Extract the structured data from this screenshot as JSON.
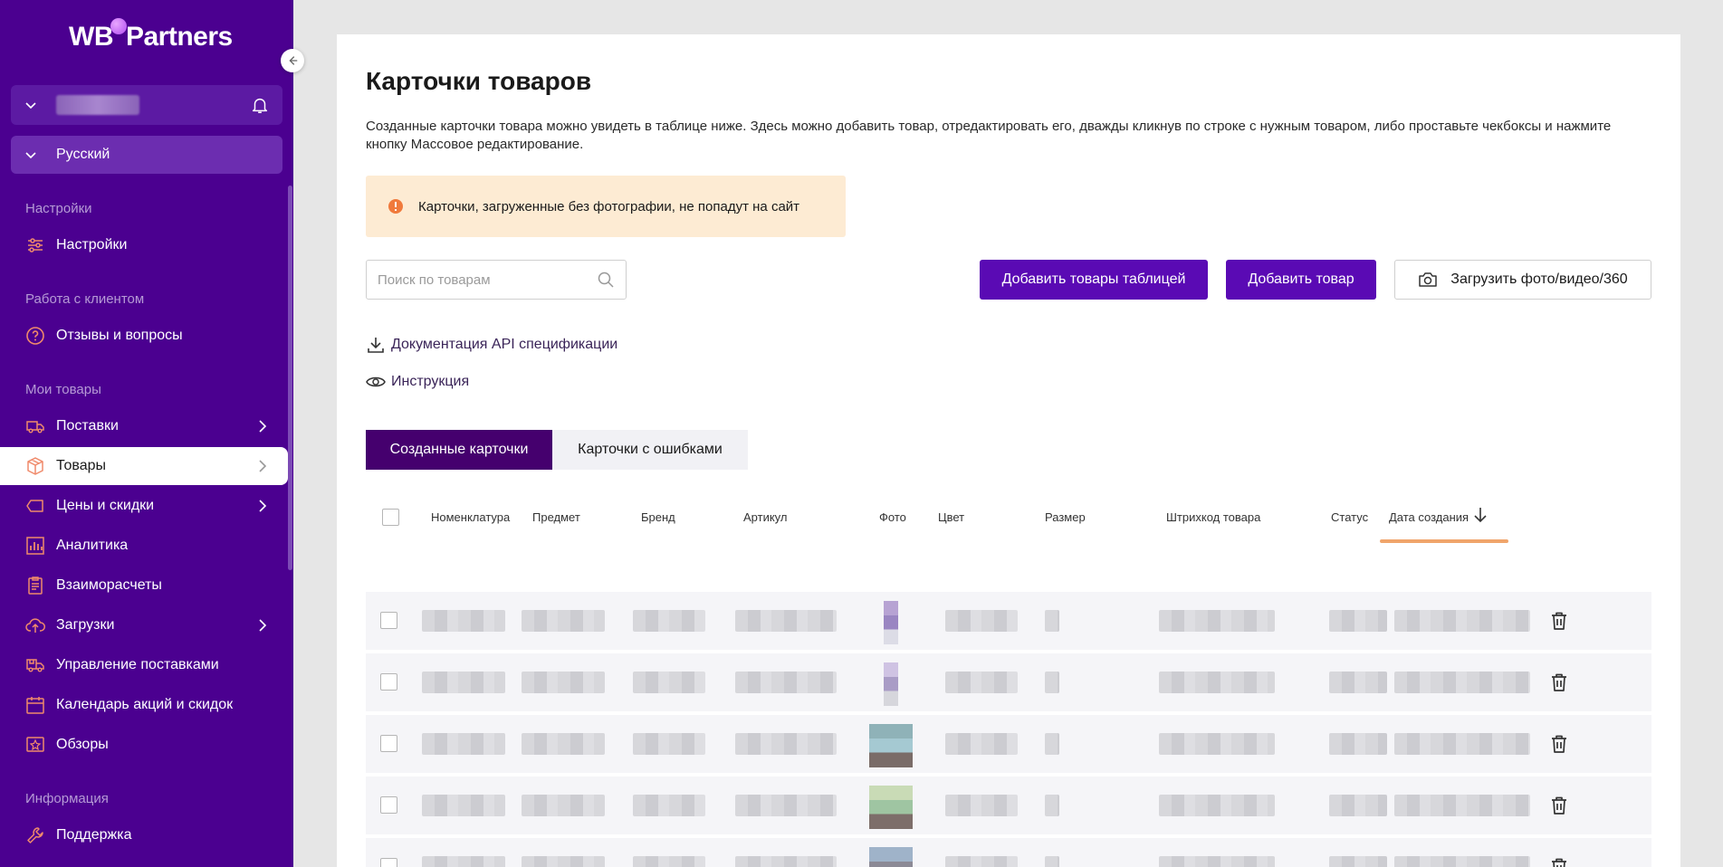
{
  "brand": {
    "logo_left": "WB",
    "logo_right": "Partners"
  },
  "sidebar": {
    "language": "Русский",
    "sections": [
      {
        "title": "Настройки",
        "items": [
          {
            "label": "Настройки",
            "icon": "sliders-icon"
          }
        ]
      },
      {
        "title": "Работа с клиентом",
        "items": [
          {
            "label": "Отзывы и вопросы",
            "icon": "question-circle-icon"
          }
        ]
      },
      {
        "title": "Мои товары",
        "items": [
          {
            "label": "Поставки",
            "icon": "truck-icon",
            "has_arrow": true
          },
          {
            "label": "Товары",
            "icon": "box-icon",
            "has_arrow": true,
            "active": true
          },
          {
            "label": "Цены и скидки",
            "icon": "tag-icon",
            "has_arrow": true
          },
          {
            "label": "Аналитика",
            "icon": "bar-chart-icon"
          },
          {
            "label": "Взаиморасчеты",
            "icon": "clipboard-icon"
          },
          {
            "label": "Загрузки",
            "icon": "cloud-upload-icon",
            "has_arrow": true
          },
          {
            "label": "Управление поставками",
            "icon": "truck-box-icon"
          },
          {
            "label": "Календарь акций и скидок",
            "icon": "calendar-icon"
          },
          {
            "label": "Обзоры",
            "icon": "star-badge-icon"
          }
        ]
      },
      {
        "title": "Информация",
        "items": [
          {
            "label": "Поддержка",
            "icon": "wrench-icon"
          }
        ]
      }
    ]
  },
  "main": {
    "title": "Карточки товаров",
    "description": "Созданные карточки товара можно увидеть в таблице ниже. Здесь можно добавить товар, отредактировать его, дважды кликнув по строке с нужным товаром, либо проставьте чекбоксы и нажмите кнопку Массовое редактирование.",
    "alert": "Карточки, загруженные без фотографии, не попадут на сайт",
    "search": {
      "placeholder": "Поиск по товарам",
      "value": ""
    },
    "buttons": {
      "add_table": "Добавить товары таблицей",
      "add_item": "Добавить товар",
      "upload_media": "Загрузить фото/видео/360"
    },
    "links": {
      "api_docs": "Документация API спецификации",
      "instructions": "Инструкция"
    },
    "tabs": [
      {
        "label": "Созданные карточки",
        "active": true
      },
      {
        "label": "Карточки с ошибками",
        "active": false
      }
    ],
    "table": {
      "columns": [
        "Номенклатура",
        "Предмет",
        "Бренд",
        "Артикул",
        "Фото",
        "Цвет",
        "Размер",
        "Штрихкод товара",
        "Статус",
        "Дата создания"
      ],
      "sort_column": "Дата создания",
      "sort_direction": "desc",
      "rows": [
        {
          "photo_colors": [
            "#b7a3d3",
            "#9a86c2",
            "#dcdce6"
          ]
        },
        {
          "photo_colors": [
            "#cfc3e3",
            "#a99cc6",
            "#d6d6dc"
          ]
        },
        {
          "photo_colors": [
            "#8fb2b8",
            "#a5c9d2",
            "#7a6c68"
          ]
        },
        {
          "photo_colors": [
            "#c9dbb6",
            "#9fc5a2",
            "#7d6e6a"
          ]
        },
        {
          "photo_colors": [
            "#9fb3c9",
            "#8c8a96",
            "#b0908c"
          ]
        }
      ]
    }
  },
  "colors": {
    "sidebar": "#4b0090",
    "primary": "#5a0ab4",
    "tab_active": "#45006e",
    "alert_bg": "#fdebd3",
    "alert_icon": "#f07a3c",
    "sort_accent": "#f0a56b"
  }
}
